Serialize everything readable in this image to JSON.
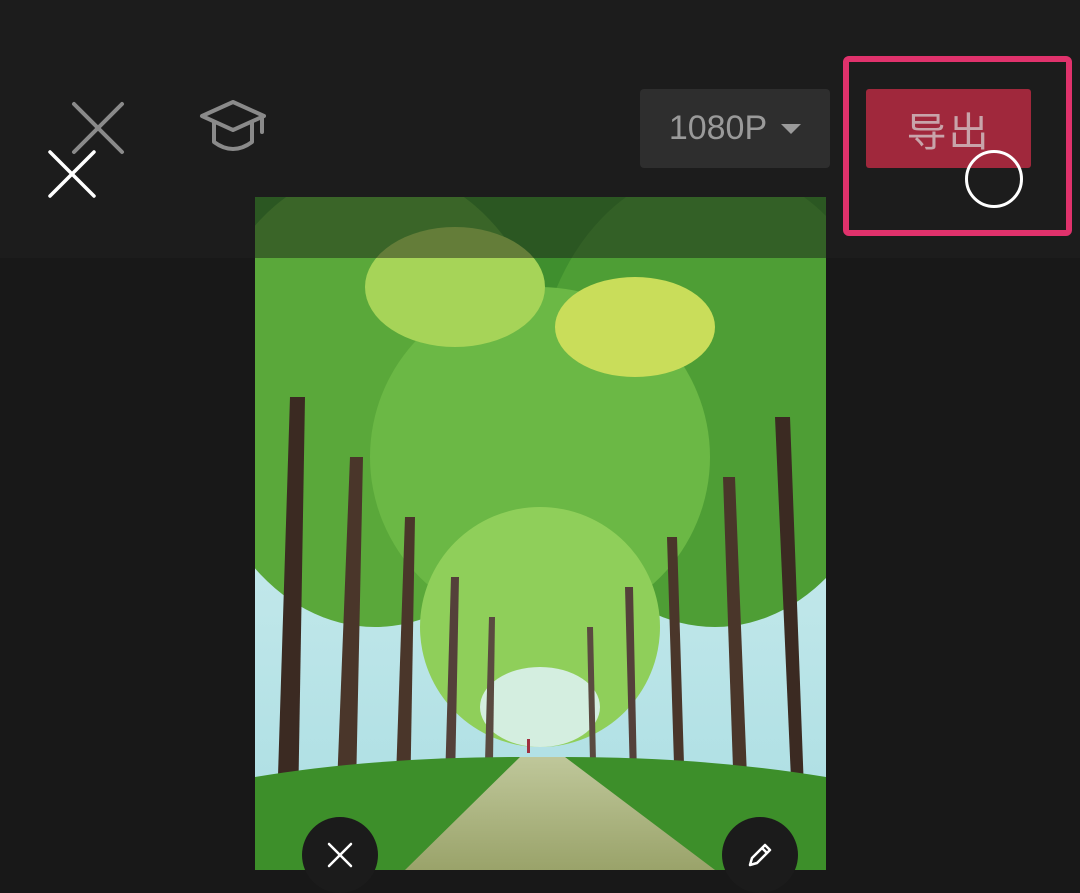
{
  "toolbar": {
    "resolution": "1080P",
    "export_label": "导出"
  },
  "icons": {
    "close": "close-icon",
    "tutorial": "graduation-cap-icon",
    "dropdown": "chevron-down-icon",
    "delete": "close-icon",
    "edit": "pencil-icon"
  },
  "colors": {
    "export_button": "#a0283c",
    "highlight": "#e0326c",
    "background": "#181818"
  }
}
